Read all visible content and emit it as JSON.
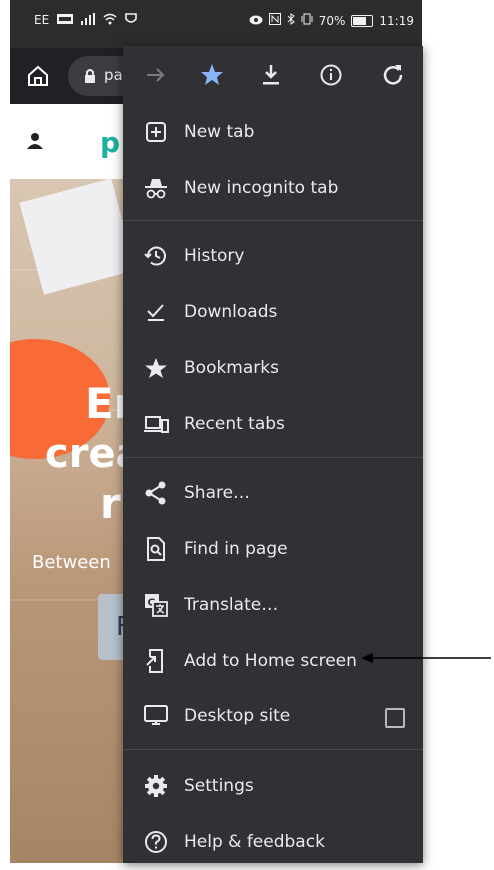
{
  "status_bar": {
    "carrier": "EE",
    "battery_percent": "70%",
    "battery_level": 0.7,
    "time": "11:19",
    "icons": [
      "volte-icon",
      "signal-icon",
      "wifi-icon",
      "shield-app-icon",
      "eye-icon",
      "nfc-icon",
      "bluetooth-icon",
      "vibrate-icon",
      "battery-icon"
    ]
  },
  "browser_toolbar": {
    "url_partial": "pa",
    "icons": [
      "home-icon",
      "lock-icon"
    ]
  },
  "page_behind": {
    "logo_partial": "p",
    "hero_line1": "Er",
    "hero_line2": "crea",
    "hero_line3": "r",
    "hero_subtitle": "Between",
    "hero_button_partial": "F"
  },
  "menu": {
    "toolbar_icons": [
      "forward-icon",
      "bookmark-star-icon",
      "download-icon",
      "info-icon",
      "refresh-icon"
    ],
    "accent_color": "#8ab4f8",
    "items": [
      {
        "id": "new-tab",
        "label": "New tab",
        "icon": "new-tab-icon"
      },
      {
        "id": "new-incognito-tab",
        "label": "New incognito tab",
        "icon": "incognito-icon"
      },
      {
        "id": "history",
        "label": "History",
        "icon": "history-icon"
      },
      {
        "id": "downloads",
        "label": "Downloads",
        "icon": "downloads-icon"
      },
      {
        "id": "bookmarks",
        "label": "Bookmarks",
        "icon": "bookmarks-icon"
      },
      {
        "id": "recent-tabs",
        "label": "Recent tabs",
        "icon": "recent-tabs-icon"
      },
      {
        "id": "share",
        "label": "Share…",
        "icon": "share-icon"
      },
      {
        "id": "find-in-page",
        "label": "Find in page",
        "icon": "find-in-page-icon"
      },
      {
        "id": "translate",
        "label": "Translate…",
        "icon": "translate-icon"
      },
      {
        "id": "add-to-home-screen",
        "label": "Add to Home screen",
        "icon": "add-to-home-icon"
      },
      {
        "id": "desktop-site",
        "label": "Desktop site",
        "icon": "desktop-icon",
        "checked": false
      },
      {
        "id": "settings",
        "label": "Settings",
        "icon": "settings-icon"
      },
      {
        "id": "help-feedback",
        "label": "Help & feedback",
        "icon": "help-icon"
      }
    ]
  }
}
